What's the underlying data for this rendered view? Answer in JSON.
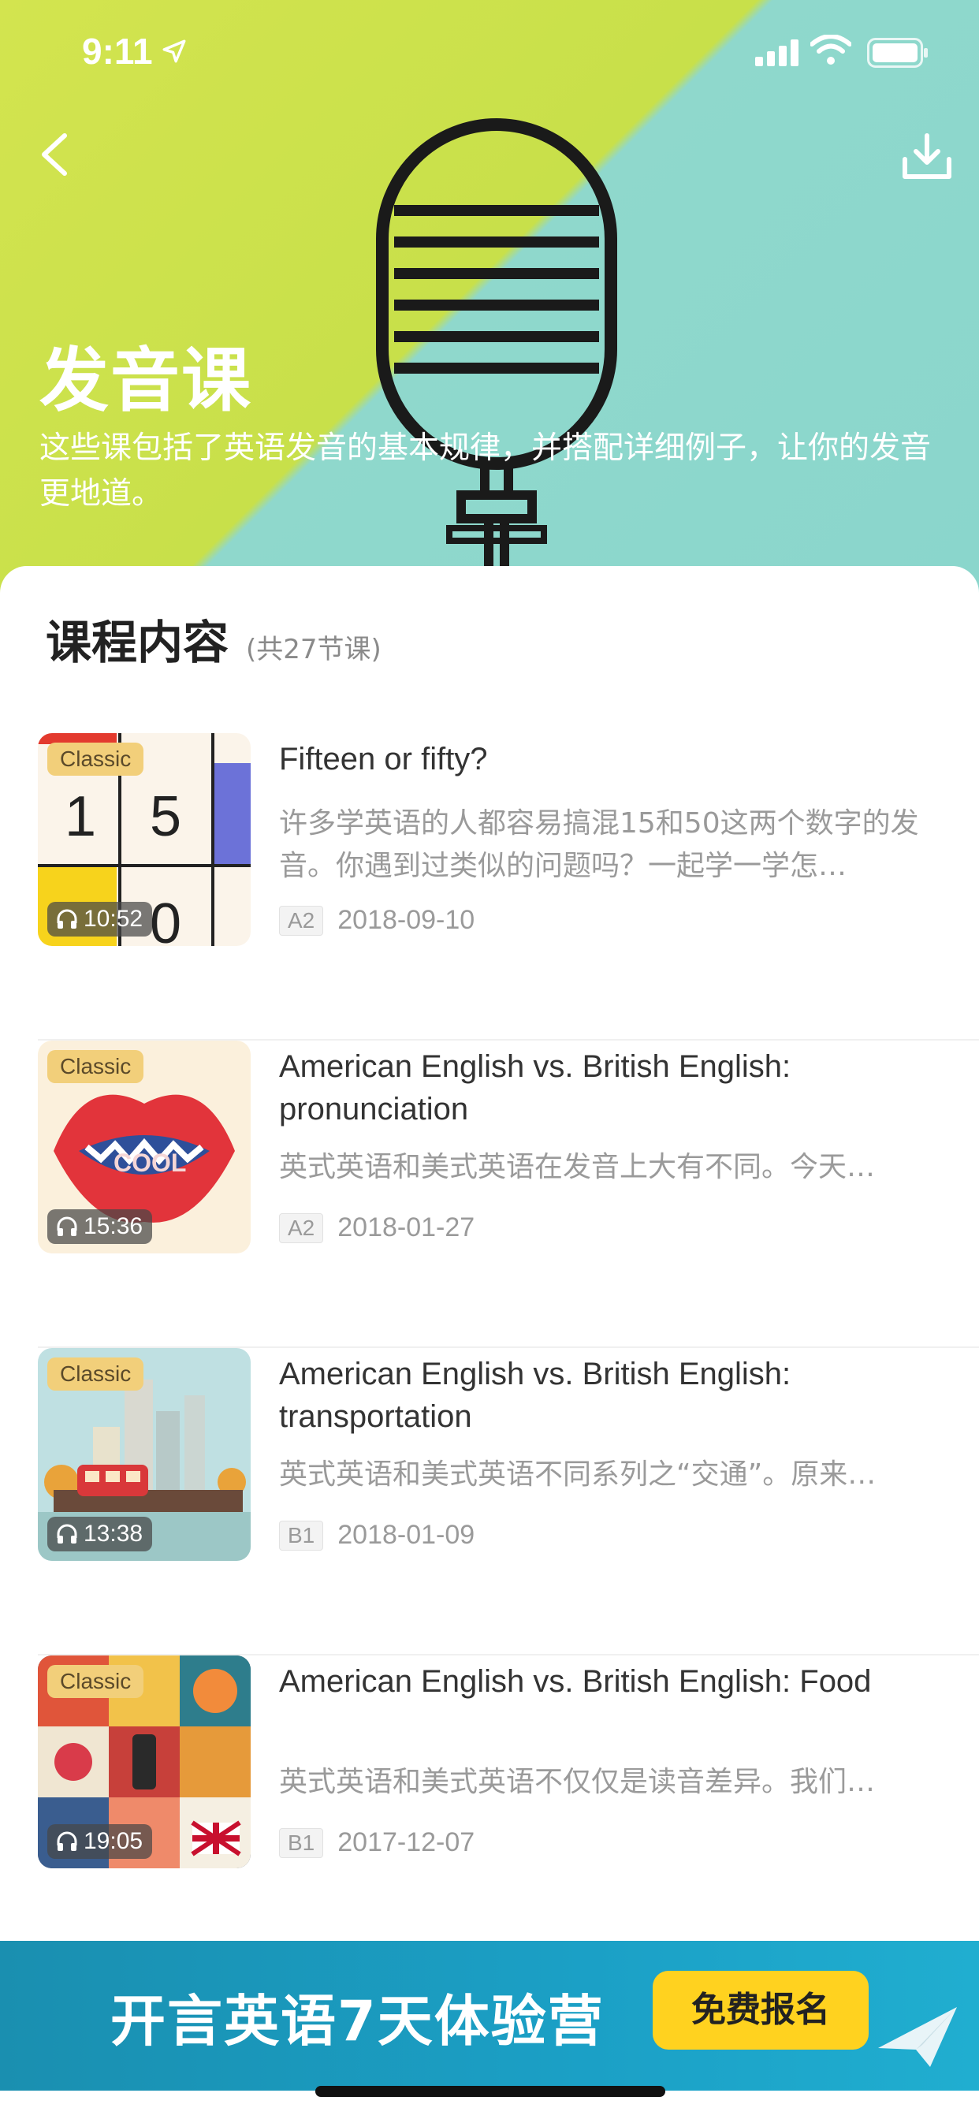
{
  "status_bar": {
    "time": "9:11"
  },
  "header": {
    "title": "发音课",
    "description": "这些课包括了英语发音的基本规律，并搭配详细例子，让你的发音更地道。"
  },
  "section": {
    "title": "课程内容",
    "count": "(共27节课)"
  },
  "lessons": [
    {
      "badge": "Classic",
      "duration": "10:52",
      "title": "Fifteen or fifty?",
      "description": "许多学英语的人都容易搞混15和50这两个数字的发音。你遇到过类似的问题吗？一起学一学怎…",
      "level": "A2",
      "date": "2018-09-10",
      "thumb_text": [
        "1",
        "5",
        "0"
      ]
    },
    {
      "badge": "Classic",
      "duration": "15:36",
      "title": "American English vs. British English: pronunciation",
      "description": "英式英语和美式英语在发音上大有不同。今天…",
      "level": "A2",
      "date": "2018-01-27",
      "thumb_text": "COOL"
    },
    {
      "badge": "Classic",
      "duration": "13:38",
      "title": "American English vs. British English: transportation",
      "description": "英式英语和美式英语不同系列之“交通”。原来…",
      "level": "B1",
      "date": "2018-01-09"
    },
    {
      "badge": "Classic",
      "duration": "19:05",
      "title": "American English vs. British English: Food",
      "description": "英式英语和美式英语不仅仅是读音差异。我们…",
      "level": "B1",
      "date": "2017-12-07"
    }
  ],
  "banner": {
    "text": "开言英语7天体验营",
    "button": "免费报名"
  },
  "icons": {
    "back": "chevron-left-icon",
    "download": "download-icon",
    "headphones": "headphones-icon",
    "plane": "paper-plane-icon"
  },
  "colors": {
    "hero_green": "#d3e44f",
    "hero_teal": "#8ad6cc",
    "banner_blue": "#1ba0c6",
    "banner_button": "#ffd21f",
    "badge": "#f2cf7a"
  }
}
